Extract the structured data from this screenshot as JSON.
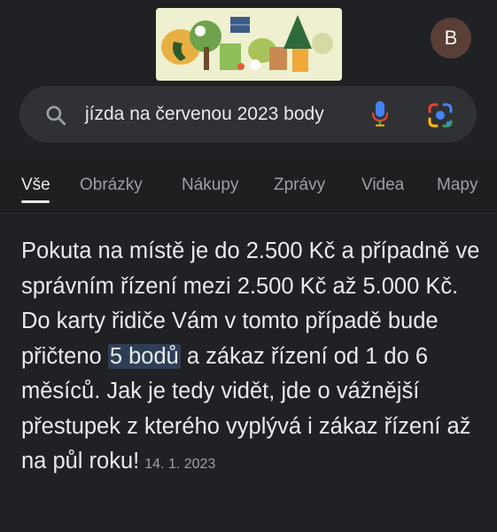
{
  "header": {
    "doodle_alt": "Google Doodle",
    "avatar_letter": "B"
  },
  "search": {
    "query": "jízda na červenou 2023 body"
  },
  "tabs": [
    {
      "label": "Vše"
    },
    {
      "label": "Obrázky"
    },
    {
      "label": "Nákupy"
    },
    {
      "label": "Zprávy"
    },
    {
      "label": "Videa"
    },
    {
      "label": "Mapy"
    }
  ],
  "snippet": {
    "text_before": "Pokuta na místě je do 2.500 Kč a případně ve správním řízení mezi 2.500 Kč až 5.000 Kč. Do karty řidiče Vám v tomto případě bude přičteno ",
    "highlight": "5 bodů",
    "text_after": " a zákaz řízení od 1 do 6 měsíců. Jak je tedy vidět, jde o vážnější přestupek z kterého vyplývá i zákaz řízení až na půl roku!",
    "date": "14. 1. 2023"
  },
  "colors": {
    "background": "#202124",
    "search_bg": "#303134",
    "highlight_bg": "#2f3e54",
    "avatar_bg": "#5a3e38"
  }
}
